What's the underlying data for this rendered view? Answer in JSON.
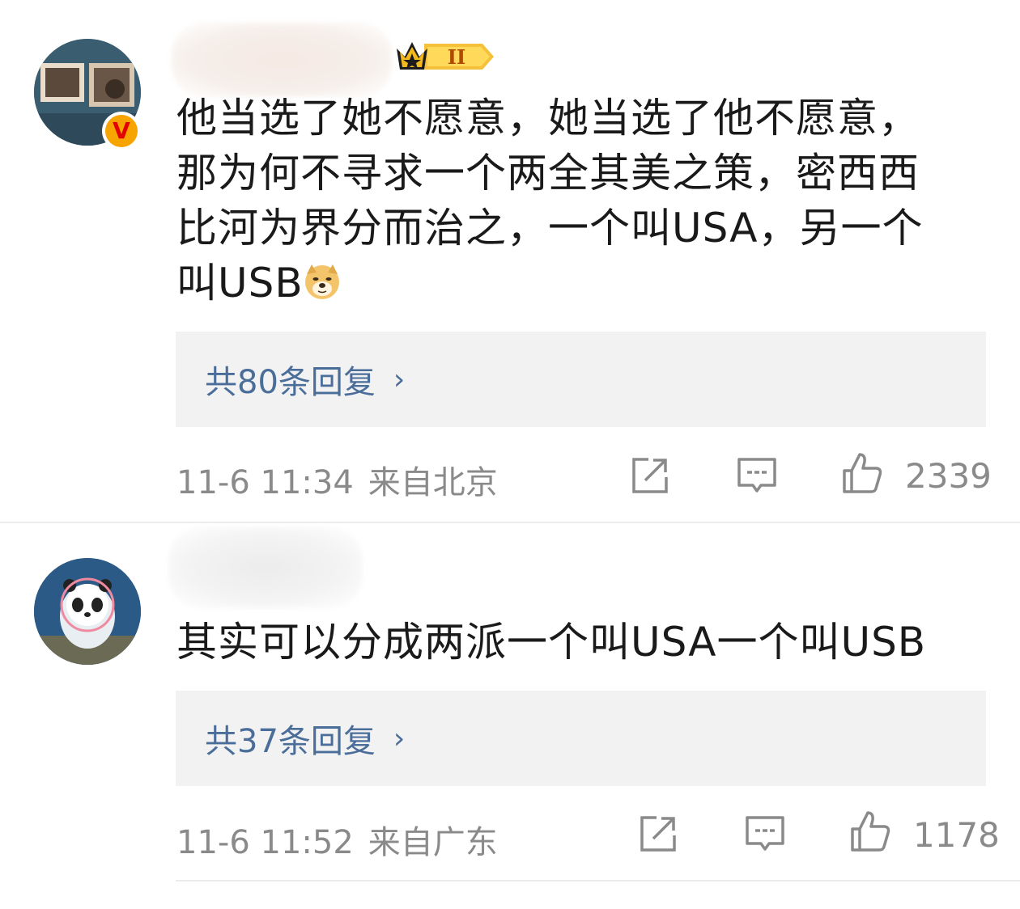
{
  "comments": [
    {
      "username": "",
      "verified_badge": "V",
      "level_badge": "II",
      "text_lines": [
        "他当选了她不愿意，她当选了他不愿意，",
        "那为何不寻求一个两全其美之策，密西西",
        "比河为界分而治之，一个叫USA，另一个",
        "叫USB"
      ],
      "emoji": "doge-emoji",
      "replies_label": "共80条回复",
      "time": "11-6 11:34",
      "location": "来自北京",
      "likes": "2339"
    },
    {
      "username": "",
      "text": "其实可以分成两派一个叫USA一个叫USB",
      "replies_label": "共37条回复",
      "time": "11-6 11:52",
      "location": "来自广东",
      "likes": "1178"
    }
  ],
  "icons": {
    "share": "share-icon",
    "comment": "comment-icon",
    "like": "thumbs-up-icon",
    "chevron": "chevron-right-icon"
  },
  "chevron_glyph": "›",
  "colors": {
    "link": "#4a6e99",
    "meta": "#8a8a8a",
    "reply_bg": "#f2f2f2",
    "badge_gold": "#f7a300"
  }
}
